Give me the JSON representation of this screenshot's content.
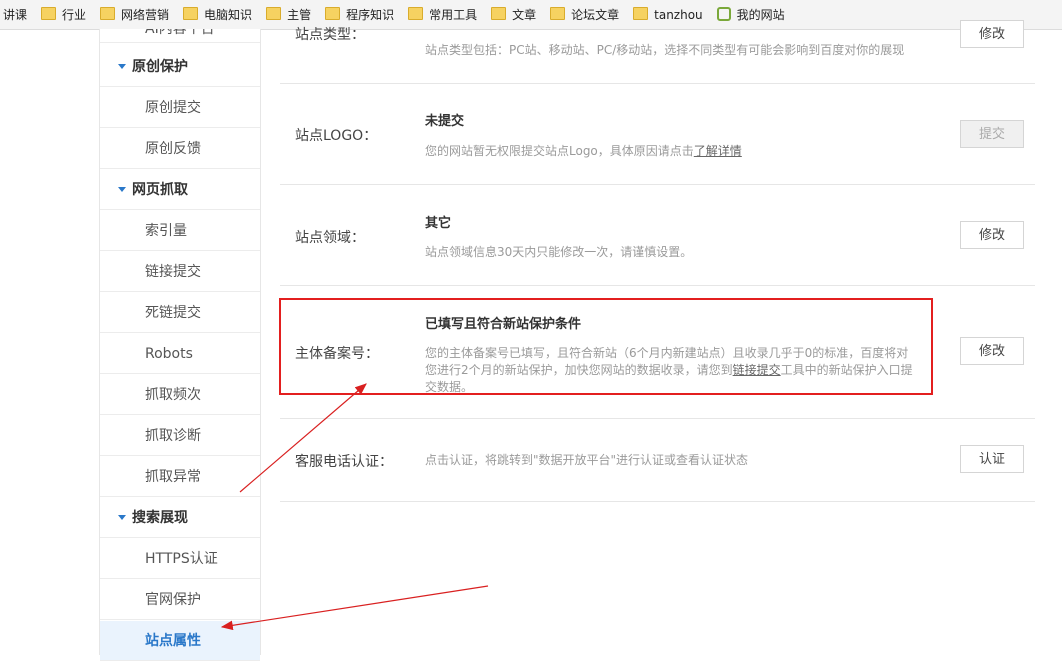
{
  "bookmarks": [
    {
      "label": "讲课",
      "icon": "none"
    },
    {
      "label": "行业",
      "icon": "folder-icon"
    },
    {
      "label": "网络营销",
      "icon": "folder-icon"
    },
    {
      "label": "电脑知识",
      "icon": "folder-icon"
    },
    {
      "label": "主管",
      "icon": "folder-icon"
    },
    {
      "label": "程序知识",
      "icon": "folder-icon"
    },
    {
      "label": "常用工具",
      "icon": "folder-icon"
    },
    {
      "label": "文章",
      "icon": "folder-icon"
    },
    {
      "label": "论坛文章",
      "icon": "folder-icon"
    },
    {
      "label": "tanzhou",
      "icon": "folder-icon"
    },
    {
      "label": "我的网站",
      "icon": "site-icon"
    }
  ],
  "sidebar": {
    "items": [
      {
        "label": "AI内容平台",
        "type": "cut"
      },
      {
        "label": "原创保护",
        "type": "group"
      },
      {
        "label": "原创提交",
        "type": "sub"
      },
      {
        "label": "原创反馈",
        "type": "sub"
      },
      {
        "label": "网页抓取",
        "type": "group"
      },
      {
        "label": "索引量",
        "type": "sub"
      },
      {
        "label": "链接提交",
        "type": "sub"
      },
      {
        "label": "死链提交",
        "type": "sub"
      },
      {
        "label": "Robots",
        "type": "sub"
      },
      {
        "label": "抓取频次",
        "type": "sub"
      },
      {
        "label": "抓取诊断",
        "type": "sub"
      },
      {
        "label": "抓取异常",
        "type": "sub"
      },
      {
        "label": "搜索展现",
        "type": "group"
      },
      {
        "label": "HTTPS认证",
        "type": "sub"
      },
      {
        "label": "官网保护",
        "type": "sub"
      },
      {
        "label": "站点属性",
        "type": "active"
      }
    ]
  },
  "rows": {
    "site_type": {
      "label": "站点类型：",
      "desc": "站点类型包括：PC站、移动站、PC/移动站，选择不同类型有可能会影响到百度对你的展现",
      "button": "修改"
    },
    "site_logo": {
      "label": "站点LOGO：",
      "value": "未提交",
      "desc_prefix": "您的网站暂无权限提交站点Logo，具体原因请点击",
      "desc_link": "了解详情",
      "button": "提交"
    },
    "site_domain": {
      "label": "站点领域：",
      "value": "其它",
      "desc": "站点领域信息30天内只能修改一次，请谨慎设置。",
      "button": "修改"
    },
    "icp": {
      "label": "主体备案号：",
      "value": "已填写且符合新站保护条件",
      "desc_prefix": "您的主体备案号已填写，且符合新站（6个月内新建站点）且收录几乎于0的标准，百度将对您进行2个月的新站保护，加快您网站的数据收录，请您到",
      "desc_link": "链接提交",
      "desc_suffix": "工具中的新站保护入口提交数据。",
      "button": "修改"
    },
    "phone": {
      "label": "客服电话认证：",
      "desc": "点击认证，将跳转到\"数据开放平台\"进行认证或查看认证状态",
      "button": "认证"
    }
  },
  "annotation": {
    "box_color": "#e31f1f",
    "arrow_color": "#d92020"
  }
}
